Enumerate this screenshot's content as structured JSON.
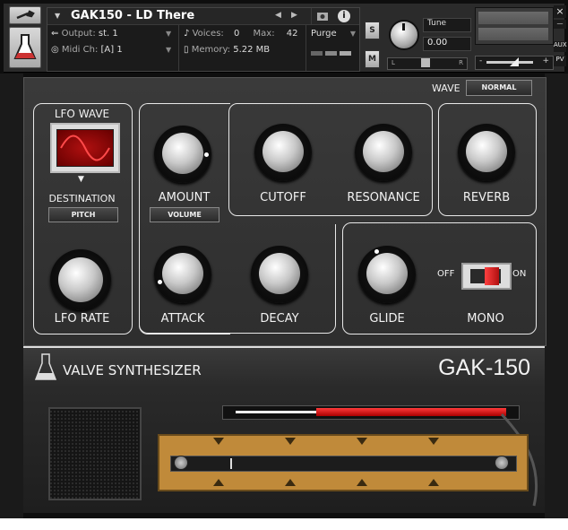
{
  "header": {
    "instrument_name": "GAK150 - LD There",
    "output_label": "Output:",
    "output_value": "st. 1",
    "midi_label": "Midi Ch:",
    "midi_value": "[A] 1",
    "voices_label": "Voices:",
    "voices_value": "0",
    "max_label": "Max:",
    "max_value": "42",
    "memory_label": "Memory:",
    "memory_value": "5.22 MB",
    "purge_label": "Purge",
    "solo_label": "S",
    "mute_label": "M",
    "tune_label": "Tune",
    "tune_value": "0.00",
    "pan_left": "L",
    "pan_right": "R",
    "vol_minus": "-",
    "vol_plus": "+",
    "close_glyph": "×",
    "aux_label": "AUX",
    "pv_label": "PV"
  },
  "synth": {
    "wave_label": "WAVE",
    "wave_mode": "NORMAL",
    "lfo_wave_label": "LFO WAVE",
    "destination_label": "DESTINATION",
    "destination_value": "PITCH",
    "lfo_rate_label": "LFO RATE",
    "amount_label": "AMOUNT",
    "amount_target": "VOLUME",
    "cutoff_label": "CUTOFF",
    "resonance_label": "RESONANCE",
    "reverb_label": "REVERB",
    "attack_label": "ATTACK",
    "decay_label": "DECAY",
    "glide_label": "GLIDE",
    "mono_label": "MONO",
    "off_label": "OFF",
    "on_label": "ON"
  },
  "footer": {
    "brand": "VALVE SYNTHESIZER",
    "model": "GAK-150"
  },
  "colors": {
    "accent_red": "#cc1a1a",
    "strip_wood": "#c08a3a",
    "panel": "#333333"
  }
}
